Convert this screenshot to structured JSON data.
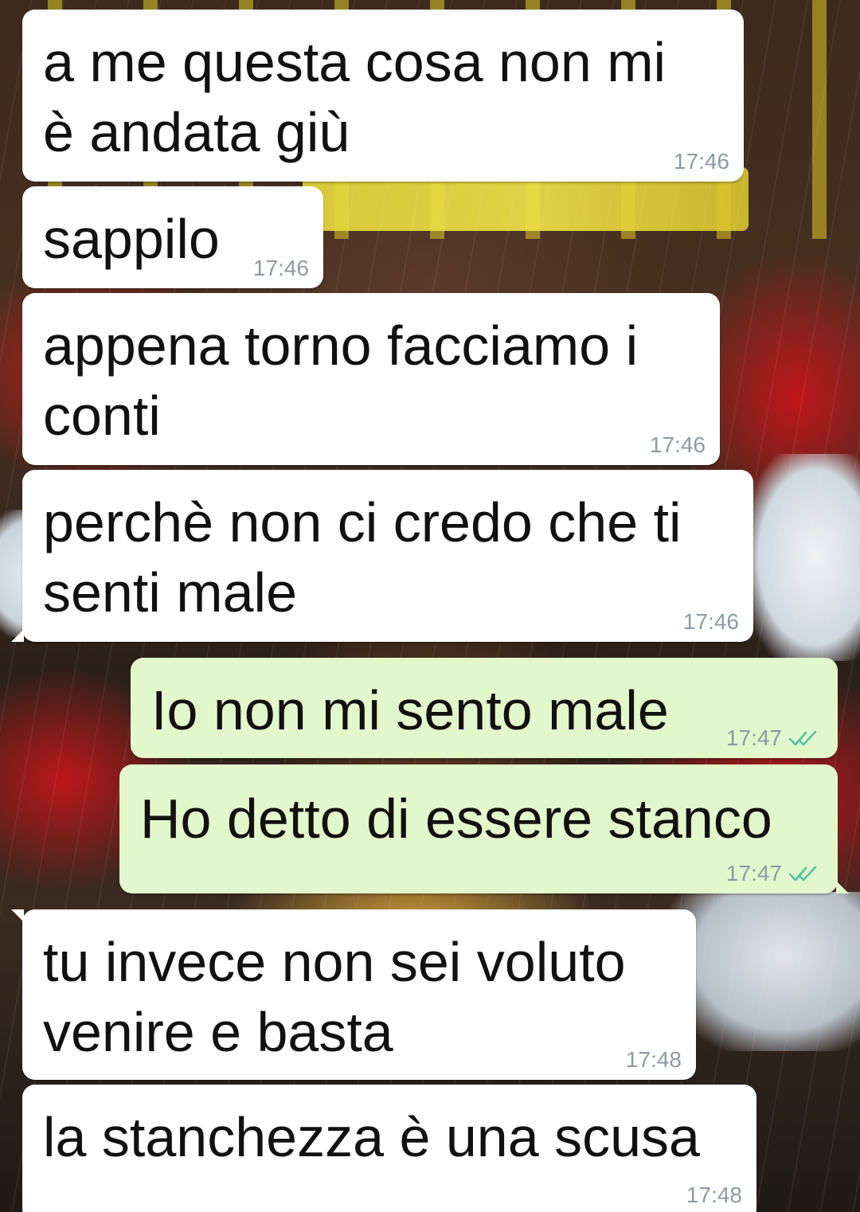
{
  "messages": [
    {
      "text": "a me questa cosa non mi\nè andata giù",
      "time": "17:46",
      "direction": "incoming"
    },
    {
      "text": "sappilo",
      "time": "17:46",
      "direction": "incoming"
    },
    {
      "text": "appena torno facciamo i\nconti",
      "time": "17:46",
      "direction": "incoming"
    },
    {
      "text": "perchè non ci credo che ti\nsenti male",
      "time": "17:46",
      "direction": "incoming"
    },
    {
      "text": "Io non mi sento male",
      "time": "17:47",
      "direction": "outgoing",
      "status": "read"
    },
    {
      "text": "Ho detto di essere stanco",
      "time": "17:47",
      "direction": "outgoing",
      "status": "read"
    },
    {
      "text": "tu invece non sei voluto\nvenire e basta",
      "time": "17:48",
      "direction": "incoming"
    },
    {
      "text": "la stanchezza è una scusa",
      "time": "17:48",
      "direction": "incoming"
    }
  ],
  "icons": {
    "read_ticks": "double-check-icon"
  },
  "colors": {
    "incoming_bubble": "#ffffff",
    "outgoing_bubble": "#e2f7cb",
    "timestamp": "#8c9aa3",
    "read_ticks": "#4fc3a6"
  }
}
